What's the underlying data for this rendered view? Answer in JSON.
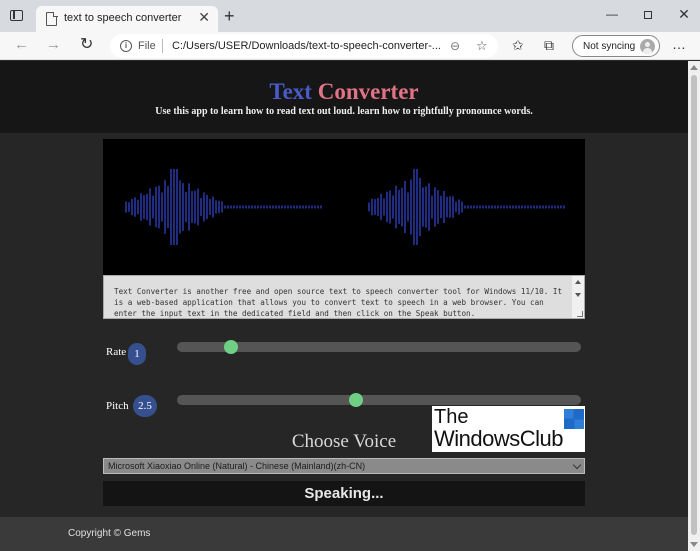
{
  "browser": {
    "tab_title": "text to speech converter",
    "tab_close": "✕",
    "new_tab": "+",
    "win_min": "—",
    "win_close": "✕",
    "address_label": "File",
    "address_url": "C:/Users/USER/Downloads/text-to-speech-converter-...",
    "sync_label": "Not syncing",
    "more": "…"
  },
  "site": {
    "title_part1": "Text",
    "title_part2": "Converter",
    "subtitle": "Use this app to learn how to read text out loud. learn how to rightfully pronounce words.",
    "textarea_value": "Text Converter is another free and open source text to speech converter tool for Windows 11/10. It is a web-based application that allows you to convert text to speech in a web browser. You can enter the input text in the dedicated field and then click on the Speak button.",
    "rate_label": "Rate",
    "rate_value": "1",
    "rate_fraction": 0.12,
    "pitch_label": "Pitch",
    "pitch_value": "2.5",
    "pitch_fraction": 0.44,
    "choose_voice_label": "Choose Voice",
    "voice_selected": "Microsoft Xiaoxiao Online (Natural) - Chinese (Mainland)(zh-CN)",
    "speak_button": "Speaking...",
    "footer_text": "Copyright © Gems"
  },
  "watermark": {
    "line1": "The",
    "line2": "WindowsClub"
  },
  "colors": {
    "title_word1": "#4a5bc9",
    "title_word2": "#e07386",
    "waveform": "#2f3fb8",
    "slider_knob": "#6fcf85",
    "badge": "#364f8f"
  }
}
